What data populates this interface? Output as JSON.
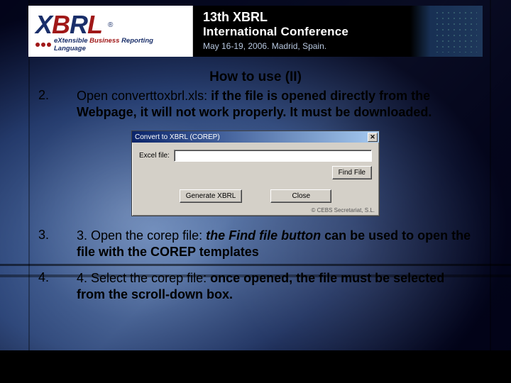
{
  "header": {
    "logo_letters": {
      "x": "X",
      "b": "B",
      "r": "R",
      "l": "L"
    },
    "reg_mark": "®",
    "tagline_prefix": "eXtensible ",
    "tagline_mid": "Business ",
    "tagline_suffix": "Reporting Language",
    "conf_line1": "13th XBRL",
    "conf_line2": "International Conference",
    "conf_date": "May 16-19, 2006. Madrid, Spain."
  },
  "slide": {
    "title": "How to use (II)",
    "items": [
      {
        "num": "2.",
        "plain": "Open converttoxbrl.xls: ",
        "bold": "if the file is opened directly from the Webpage, it will not work properly. It must be downloaded."
      },
      {
        "num": "3.",
        "plain": "3. Open the corep file: ",
        "italic": "the Find file button",
        "bold": " can be used to open the file with the COREP templates"
      },
      {
        "num": "4.",
        "plain": "4. Select the corep file: ",
        "bold": "once opened, the file must be selected from the scroll-down box."
      }
    ]
  },
  "dialog": {
    "title": "Convert to XBRL (COREP)",
    "close": "✕",
    "excel_label": "Excel file:",
    "find_file": "Find File",
    "generate": "Generate XBRL",
    "close_btn": "Close",
    "copyright": "© CEBS Secretariat, S.L."
  }
}
